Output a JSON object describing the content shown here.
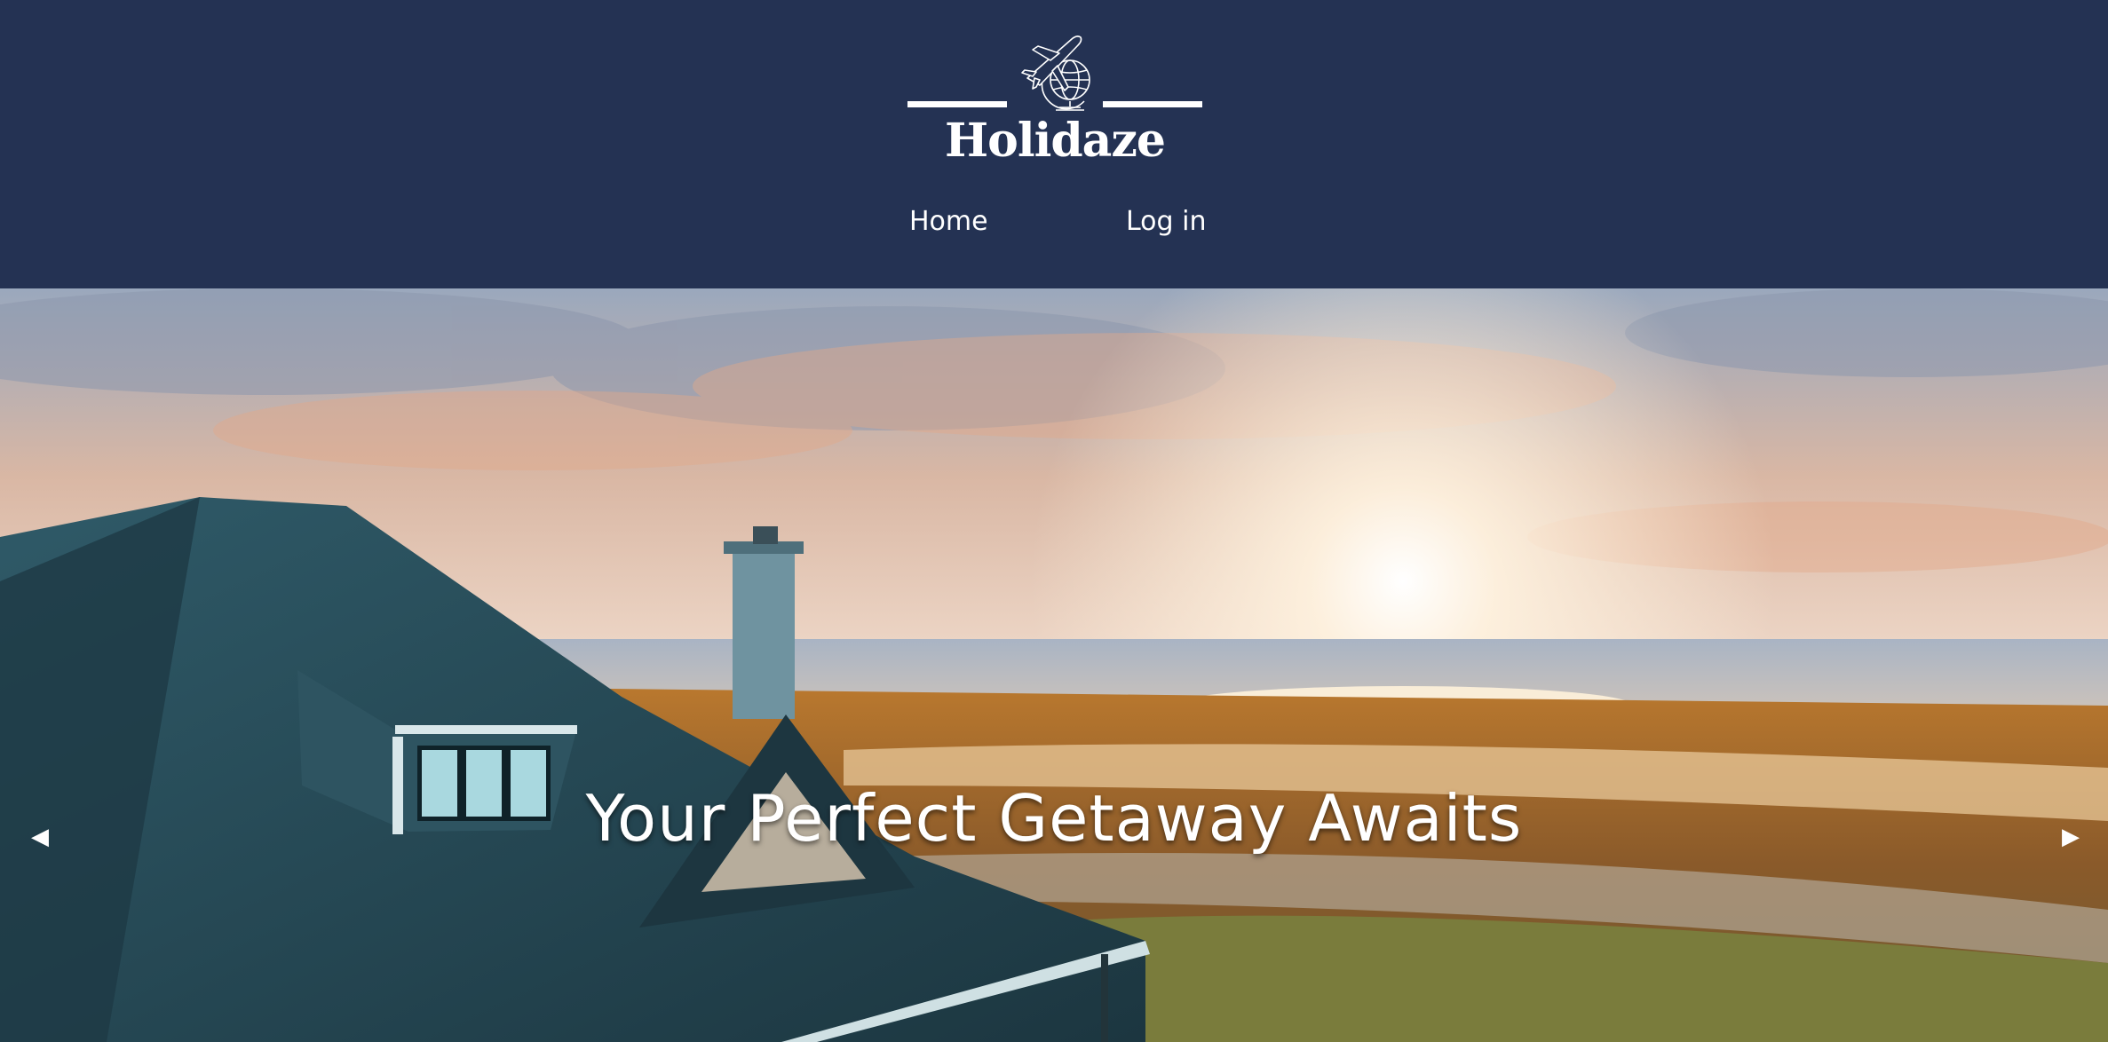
{
  "header": {
    "brand_name": "Holidaze",
    "logo_icon": "plane-globe-icon",
    "background_color": "#243253"
  },
  "nav": {
    "items": [
      {
        "label": "Home"
      },
      {
        "label": "Log in"
      }
    ]
  },
  "hero": {
    "title": "Your Perfect Getaway Awaits",
    "image_description_icon": "beach-house-sunset-image",
    "prev_arrow": "◀",
    "next_arrow": "▶"
  }
}
